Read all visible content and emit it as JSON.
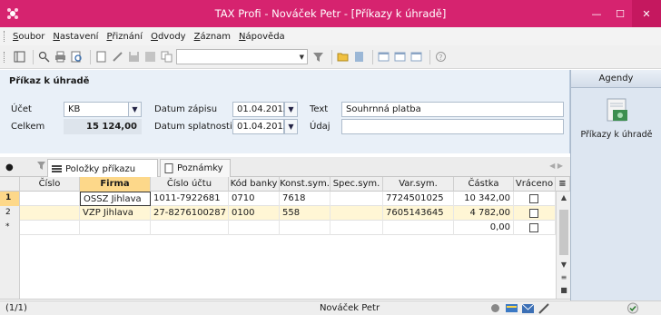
{
  "window": {
    "title": "TAX Profi - Nováček Petr - [Příkazy k úhradě]"
  },
  "menu": [
    "Soubor",
    "Nastavení",
    "Přiznání",
    "Odvody",
    "Záznam",
    "Nápověda"
  ],
  "toolbar": {
    "combo_value": ""
  },
  "form": {
    "title": "Příkaz k úhradě",
    "ucet_label": "Účet",
    "ucet_value": "KB",
    "celkem_label": "Celkem",
    "celkem_value": "15 124,00",
    "datum_zapisu_label": "Datum zápisu",
    "datum_zapisu_value": "01.04.2015",
    "datum_splatnosti_label": "Datum splatnosti",
    "datum_splatnosti_value": "01.04.2015",
    "text_label": "Text",
    "text_value": "Souhrnná platba",
    "udaj_label": "Údaj",
    "udaj_value": ""
  },
  "tabs": [
    {
      "label": "Položky příkazu",
      "active": true
    },
    {
      "label": "Poznámky",
      "active": false
    }
  ],
  "grid": {
    "columns": [
      "Číslo",
      "Firma",
      "Číslo účtu",
      "Kód banky",
      "Konst.sym.",
      "Spec.sym.",
      "Var.sym.",
      "Částka",
      "Vráceno"
    ],
    "sorted_column": "Firma",
    "rows": [
      {
        "row": "1",
        "cislo": "",
        "firma": "OSSZ Jihlava",
        "ucet": "1011-7922681",
        "kod": "0710",
        "konst": "7618",
        "spec": "",
        "var": "7724501025",
        "castka": "10 342,00",
        "vraceno": false
      },
      {
        "row": "2",
        "cislo": "",
        "firma": "VZP Jihlava",
        "ucet": "27-8276100287",
        "kod": "0100",
        "konst": "558",
        "spec": "",
        "var": "7605143645",
        "castka": "4 782,00",
        "vraceno": false
      },
      {
        "row": "*",
        "cislo": "",
        "firma": "",
        "ucet": "",
        "kod": "",
        "konst": "",
        "spec": "",
        "var": "",
        "castka": "0,00",
        "vraceno": false
      }
    ]
  },
  "agendy": {
    "header": "Agendy",
    "items": [
      {
        "label": "Příkazy k úhradě"
      }
    ]
  },
  "status": {
    "record": "(1/1)",
    "user": "Nováček Petr"
  },
  "colors": {
    "titlebar": "#d6236f",
    "sorted_header": "#fdd88a",
    "alt_row": "#fff6d5",
    "form_bg": "#e9f0f8"
  }
}
